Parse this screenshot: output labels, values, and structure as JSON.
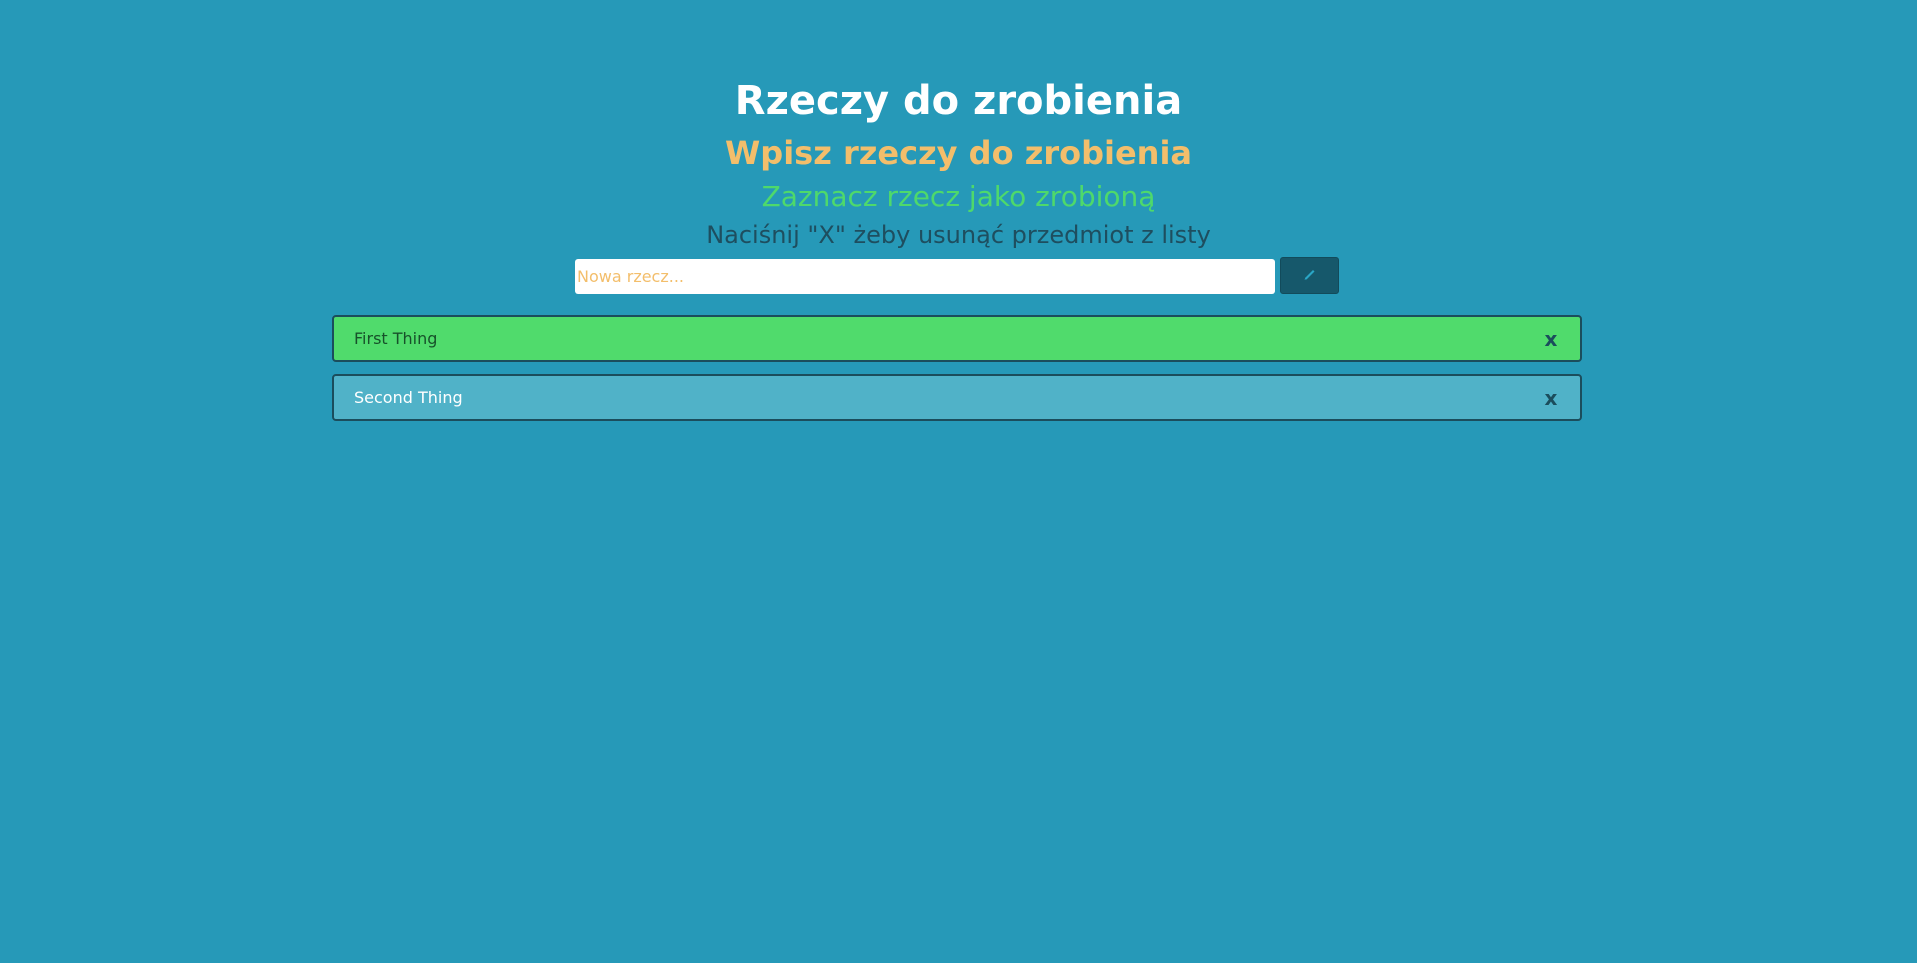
{
  "header": {
    "title": "Rzeczy do zrobienia",
    "subtitle": "Wpisz rzeczy do zrobienia",
    "hint_done": "Zaznacz rzecz jako zrobioną",
    "hint_remove": "Naciśnij \"X\" żeby usunąć przedmiot z listy"
  },
  "form": {
    "input_value": "",
    "input_placeholder": "Nowa rzecz...",
    "add_button_icon": "pencil-icon"
  },
  "todos": [
    {
      "text": "First Thing",
      "done": true,
      "remove_label": "x"
    },
    {
      "text": "Second Thing",
      "done": false,
      "remove_label": "x"
    }
  ],
  "colors": {
    "background": "#2699b8",
    "title": "#ffffff",
    "subtitle": "#f3be6b",
    "hint_done": "#4ed96b",
    "hint_remove": "#1e4e5f",
    "done_item": "#50db6c",
    "todo_item": "#50b2c8",
    "button": "#16586b"
  }
}
